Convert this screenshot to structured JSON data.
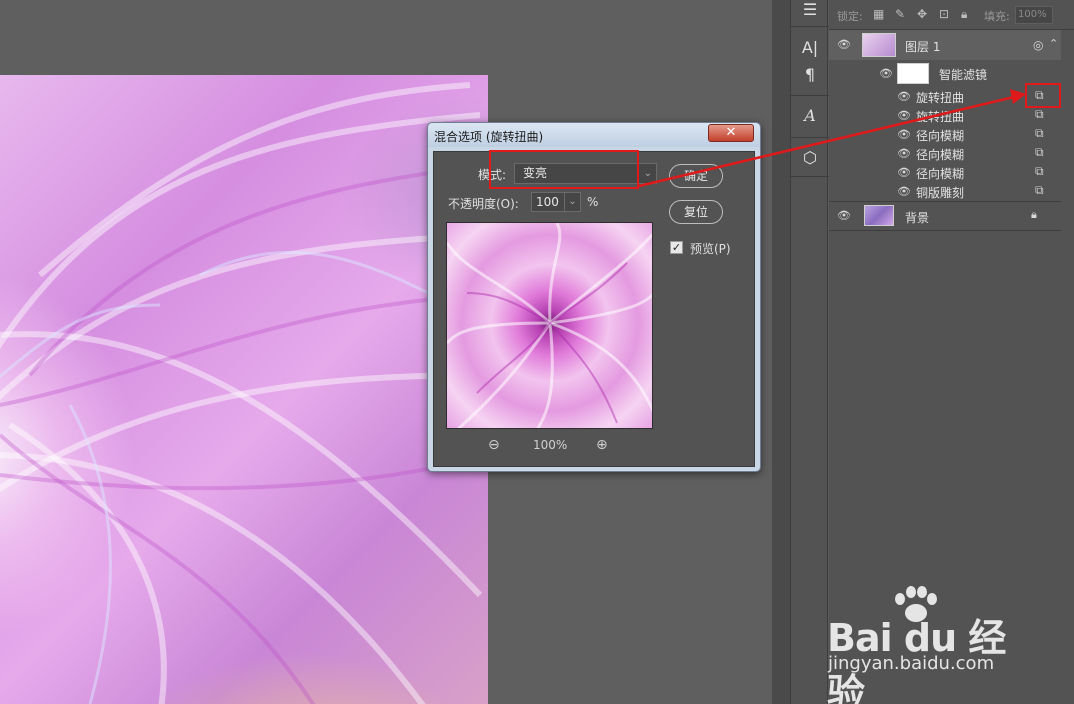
{
  "dialog": {
    "title": "混合选项 (旋转扭曲)",
    "close_glyph": "✕",
    "mode_label": "模式:",
    "mode_value": "变亮",
    "opacity_label": "不透明度(O):",
    "opacity_value": "100",
    "opacity_unit": "%",
    "ok_label": "确定",
    "reset_label": "复位",
    "preview_label": "预览(P)",
    "preview_checked": true,
    "zoom_level": "100%"
  },
  "layers": {
    "lock_label": "锁定:",
    "fill_label": "填充:",
    "fill_value": "100%",
    "layer1_name": "图层 1",
    "smart_filters_label": "智能滤镜",
    "filters": [
      "旋转扭曲",
      "旋转扭曲",
      "径向模糊",
      "径向模糊",
      "径向模糊",
      "铜版雕刻"
    ],
    "background_name": "背景"
  },
  "watermark": {
    "brand": "Bai du 经验",
    "url": "jingyan.baidu.com"
  },
  "colors": {
    "annotation": "#e01a1a",
    "panel_bg": "#535353",
    "canvas_bg": "#5f5f5f"
  }
}
